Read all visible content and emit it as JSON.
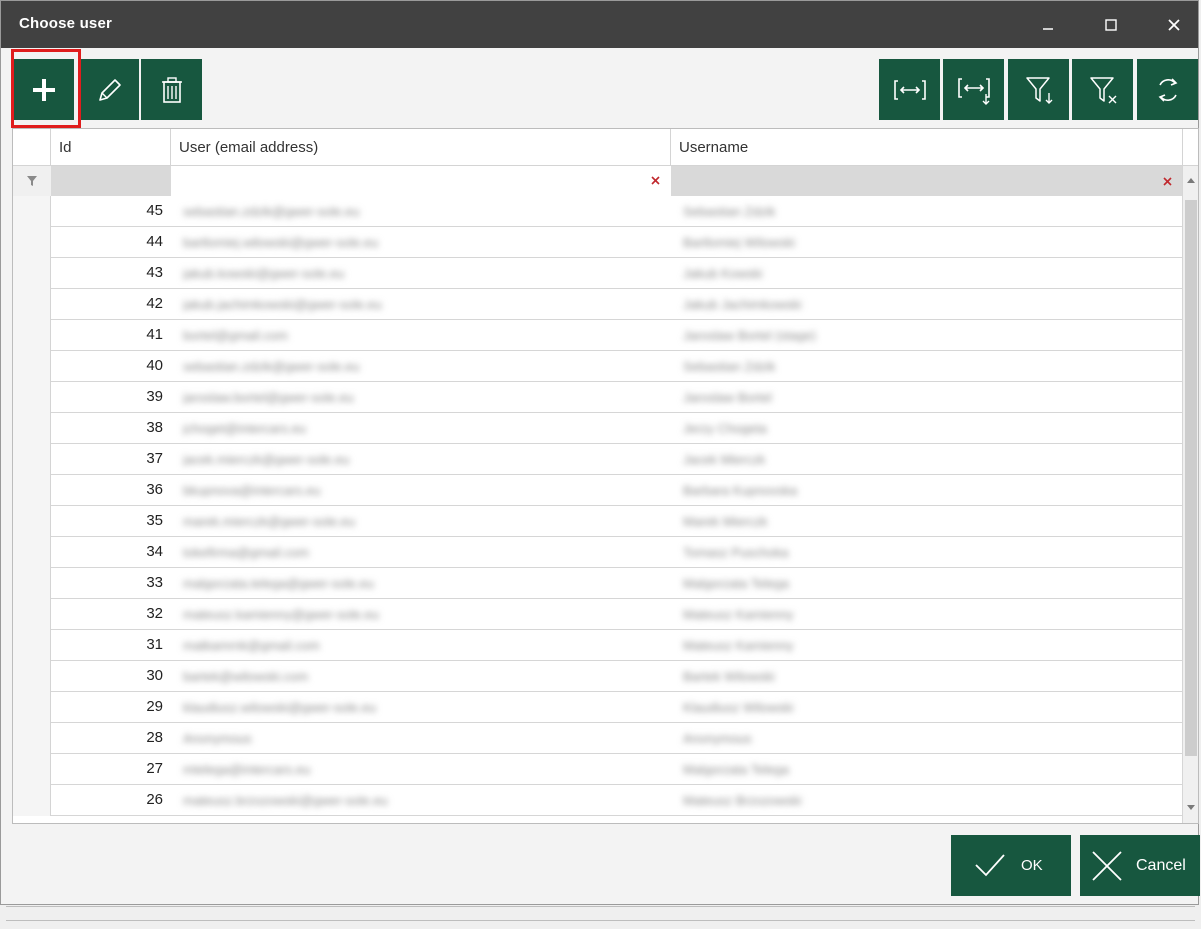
{
  "window": {
    "title": "Choose user",
    "accent": "#17573f",
    "titlebar_color": "#414141"
  },
  "toolbar": {
    "left": [
      {
        "name": "add-button",
        "icon": "plus-icon"
      },
      {
        "name": "edit-button",
        "icon": "pencil-icon"
      },
      {
        "name": "delete-button",
        "icon": "trash-icon"
      }
    ],
    "right": [
      {
        "name": "best-fit-columns-button",
        "icon": "fit-columns-icon"
      },
      {
        "name": "best-fit-all-button",
        "icon": "fit-all-icon"
      },
      {
        "name": "filter-button",
        "icon": "funnel-icon"
      },
      {
        "name": "clear-filter-button",
        "icon": "funnel-clear-icon"
      },
      {
        "name": "refresh-button",
        "icon": "refresh-icon"
      }
    ]
  },
  "grid": {
    "columns": [
      "Id",
      "User (email address)",
      "Username"
    ],
    "filter": {
      "email_value": "",
      "username_value": ""
    },
    "rows": [
      {
        "id": "45",
        "email": "sebastian.zdzik@gwer-sole.eu",
        "username": "Sebastian Zdzik"
      },
      {
        "id": "44",
        "email": "bartlomiej.wilowski@gwer-sole.eu",
        "username": "Bartlomiej Wilowski"
      },
      {
        "id": "43",
        "email": "jakub.kowski@gwer-sole.eu",
        "username": "Jakub Kowski"
      },
      {
        "id": "42",
        "email": "jakub.jachimkowski@gwer-sole.eu",
        "username": "Jakub Jachimkowski"
      },
      {
        "id": "41",
        "email": "bortel@gmail.com",
        "username": "Jaroslaw Bortel (stage)"
      },
      {
        "id": "40",
        "email": "sebastian.zdzik@gwer-sole.eu",
        "username": "Sebastian Zdzik"
      },
      {
        "id": "39",
        "email": "jaroslaw.bortel@gwer-sole.eu",
        "username": "Jaroslaw Bortel"
      },
      {
        "id": "38",
        "email": "jchoget@intercars.eu",
        "username": "Jerzy Chogeta"
      },
      {
        "id": "37",
        "email": "jacek.mierczk@gwer-sole.eu",
        "username": "Jacek Mierczk"
      },
      {
        "id": "36",
        "email": "bkupnova@intercars.eu",
        "username": "Barbara Kupnovska"
      },
      {
        "id": "35",
        "email": "marek.mierczk@gwer-sole.eu",
        "username": "Marek Mierczk"
      },
      {
        "id": "34",
        "email": "tokefirma@gmail.com",
        "username": "Tomasz Puschoka"
      },
      {
        "id": "33",
        "email": "malgorzata.telega@gwer-sole.eu",
        "username": "Malgorzata Telega"
      },
      {
        "id": "32",
        "email": "mateusz.kamienny@gwer-sole.eu",
        "username": "Mateusz Kamienny"
      },
      {
        "id": "31",
        "email": "matkamrnk@gmail.com",
        "username": "Mateusz Kamienny"
      },
      {
        "id": "30",
        "email": "bartek@wilowski.com",
        "username": "Bartek Wilowski"
      },
      {
        "id": "29",
        "email": "klaudiusz.wilowski@gwer-sole.eu",
        "username": "Klaudiusz Wilowski"
      },
      {
        "id": "28",
        "email": "Anonymous",
        "username": "Anonymous"
      },
      {
        "id": "27",
        "email": "mtelega@intercars.eu",
        "username": "Malgorzata Telega"
      },
      {
        "id": "26",
        "email": "mateusz.brzozowski@gwer-sole.eu",
        "username": "Mateusz Brzozowski"
      }
    ]
  },
  "footer": {
    "ok_label": "OK",
    "cancel_label": "Cancel"
  }
}
